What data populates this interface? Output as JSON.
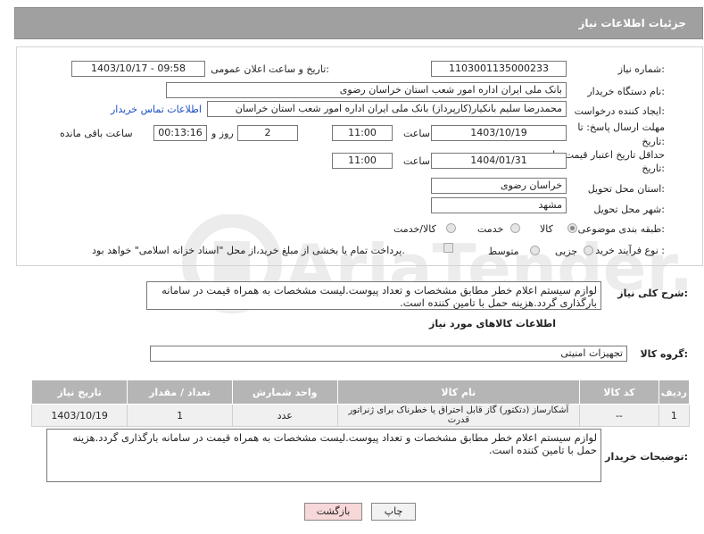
{
  "header": {
    "title": "جزئیات اطلاعات نیاز"
  },
  "form": {
    "need_number_label": "شماره نیاز:",
    "need_number": "1103001135000233",
    "announce_label": "تاریخ و ساعت اعلان عمومی:",
    "announce_value": "1403/10/17 - 09:58",
    "buyer_org_label": "نام دستگاه خریدار:",
    "buyer_org": "بانک ملی ایران اداره امور شعب استان خراسان رضوی",
    "requester_label": "ایجاد کننده درخواست:",
    "requester": "محمدرضا سلیم  بانکیار(کارپرداز) بانک ملی ایران اداره امور شعب استان خراسان",
    "contact_link": "اطلاعات تماس خریدار",
    "deadline_label": "مهلت ارسال پاسخ: تا",
    "deadline_label2": "تاریخ:",
    "deadline_date": "1403/10/19",
    "time_label": "ساعت",
    "deadline_time": "11:00",
    "days_value": "2",
    "days_label": "روز و",
    "remaining_time": "00:13:16",
    "remaining_label": "ساعت باقی مانده",
    "validity_label": "حداقل تاریخ اعتبار قیمت: تا",
    "validity_label2": "تاریخ:",
    "validity_date": "1404/01/31",
    "validity_time": "11:00",
    "province_label": "استان محل تحویل:",
    "province": "خراسان رضوی",
    "city_label": "شهر محل تحویل:",
    "city": "مشهد",
    "category_label": "طبقه بندی موضوعی:",
    "category_options": [
      "کالا",
      "خدمت",
      "کالا/خدمت"
    ],
    "process_label": "نوع فرآیند خرید :",
    "process_options": [
      "جزیی",
      "متوسط"
    ],
    "payment_note": "پرداخت تمام یا بخشی از مبلغ خرید،از محل \"اسناد خزانه اسلامی\" خواهد بود."
  },
  "description": {
    "label": "شرح کلی نیاز:",
    "text": "لوازم سیستم اعلام خطر مطابق مشخصات و تعداد پیوست.لیست مشخصات به همراه قیمت در سامانه بارگذاری گردد.هزینه حمل با تامین کننده است."
  },
  "goods": {
    "section_title": "اطلاعات کالاهای مورد نیاز",
    "group_label": "گروه کالا:",
    "group_value": "تجهیزات امنیتی",
    "columns": [
      "ردیف",
      "کد کالا",
      "نام کالا",
      "واحد شمارش",
      "تعداد / مقدار",
      "تاریخ نیاز"
    ],
    "rows": [
      [
        "1",
        "--",
        "آشکارساز (دتکتور) گاز قابل احتراق یا خطرناک برای ژنراتور قدرت",
        "عدد",
        "1",
        "1403/10/19"
      ]
    ]
  },
  "buyer_notes": {
    "label": "توضیحات خریدار:",
    "text": "لوازم سیستم اعلام خطر مطابق مشخصات و تعداد پیوست.لیست مشخصات به همراه قیمت در سامانه بارگذاری گردد.هزینه حمل با تامین کننده است."
  },
  "buttons": {
    "print": "چاپ",
    "back": "بازگشت"
  },
  "watermark": "AriaTender.neT",
  "colors": {
    "header_bg": "#a0a0a0",
    "table_header": "#b5b5b5",
    "link": "#1a4fc4",
    "back_btn_bg": "#f7d7d7"
  }
}
